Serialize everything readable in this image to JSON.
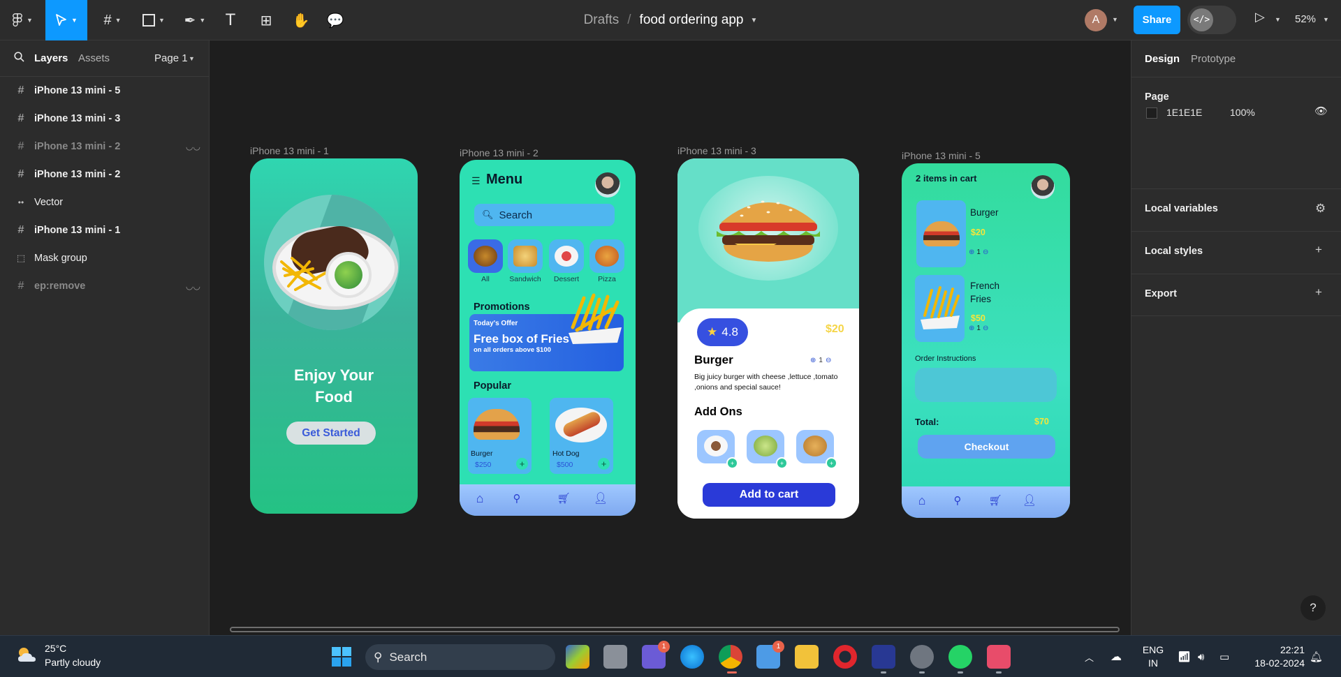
{
  "toolbar": {
    "tools": [
      "main-menu",
      "move",
      "frame",
      "shape",
      "pen",
      "text",
      "components",
      "hand",
      "comment"
    ],
    "breadcrumb_folder": "Drafts",
    "breadcrumb_separator": "/",
    "file_name": "food ordering app",
    "user_initial": "A",
    "share_label": "Share",
    "zoom": "52%"
  },
  "left_panel": {
    "tab_layers": "Layers",
    "tab_assets": "Assets",
    "page_selector": "Page 1",
    "layers": [
      {
        "name": "iPhone 13 mini - 5",
        "icon": "frame-icon",
        "hidden": false
      },
      {
        "name": "iPhone 13 mini - 3",
        "icon": "frame-icon",
        "hidden": false
      },
      {
        "name": "iPhone 13 mini - 2",
        "icon": "frame-icon",
        "hidden": true
      },
      {
        "name": "iPhone 13 mini - 2",
        "icon": "frame-icon",
        "hidden": false
      },
      {
        "name": "Vector",
        "icon": "vector-icon",
        "hidden": false
      },
      {
        "name": "iPhone 13 mini - 1",
        "icon": "frame-icon",
        "hidden": false
      },
      {
        "name": "Mask group",
        "icon": "mask-icon",
        "hidden": false
      },
      {
        "name": "ep:remove",
        "icon": "frame-icon",
        "hidden": true
      }
    ]
  },
  "canvas": {
    "frame_labels": [
      "iPhone 13 mini - 1",
      "iPhone 13 mini - 2",
      "iPhone 13 mini - 3",
      "iPhone 13 mini - 5"
    ],
    "phone1": {
      "title_line1": "Enjoy Your",
      "title_line2": "Food",
      "button": "Get Started"
    },
    "phone2": {
      "title": "Menu",
      "search_placeholder": "Search",
      "categories": [
        "All",
        "Sandwich",
        "Dessert",
        "Pizza"
      ],
      "promotions_heading": "Promotions",
      "promo_tag": "Today's Offer",
      "promo_title": "Free box of Fries",
      "promo_sub": "on all orders above $100",
      "popular_heading": "Popular",
      "popular": [
        {
          "name": "Burger",
          "price": "$250"
        },
        {
          "name": "Hot Dog",
          "price": "$500"
        }
      ]
    },
    "phone3": {
      "rating": "4.8",
      "price": "$20",
      "name": "Burger",
      "qty": "1",
      "description": "Big juicy burger with cheese ,lettuce ,tomato ,onions and special sauce!",
      "addons_heading": "Add Ons",
      "button": "Add to cart"
    },
    "phone5": {
      "title": "2 items in cart",
      "items": [
        {
          "name": "Burger",
          "price": "$20",
          "qty": "1"
        },
        {
          "name": "French Fries",
          "price": "$50",
          "qty": "1"
        }
      ],
      "instructions_label": "Order Instructions",
      "total_label": "Total:",
      "total_value": "$70",
      "button": "Checkout"
    }
  },
  "right_panel": {
    "tab_design": "Design",
    "tab_prototype": "Prototype",
    "page_heading": "Page",
    "page_color": "1E1E1E",
    "page_opacity": "100%",
    "sections": [
      "Local variables",
      "Local styles",
      "Export"
    ]
  },
  "taskbar": {
    "weather_temp": "25°C",
    "weather_desc": "Partly cloudy",
    "search": "Search",
    "lang_line1": "ENG",
    "lang_line2": "IN",
    "time": "22:21",
    "date": "18-02-2024",
    "badges": {
      "teams": "1",
      "store": "1"
    }
  },
  "colors": {
    "accent": "#0d99ff",
    "canvas_bg": "#1e1e1e",
    "panel_bg": "#2c2c2c",
    "mint": "#2de0b3",
    "primary_blue": "#2a3ad8",
    "price_yellow": "#f5d547"
  }
}
